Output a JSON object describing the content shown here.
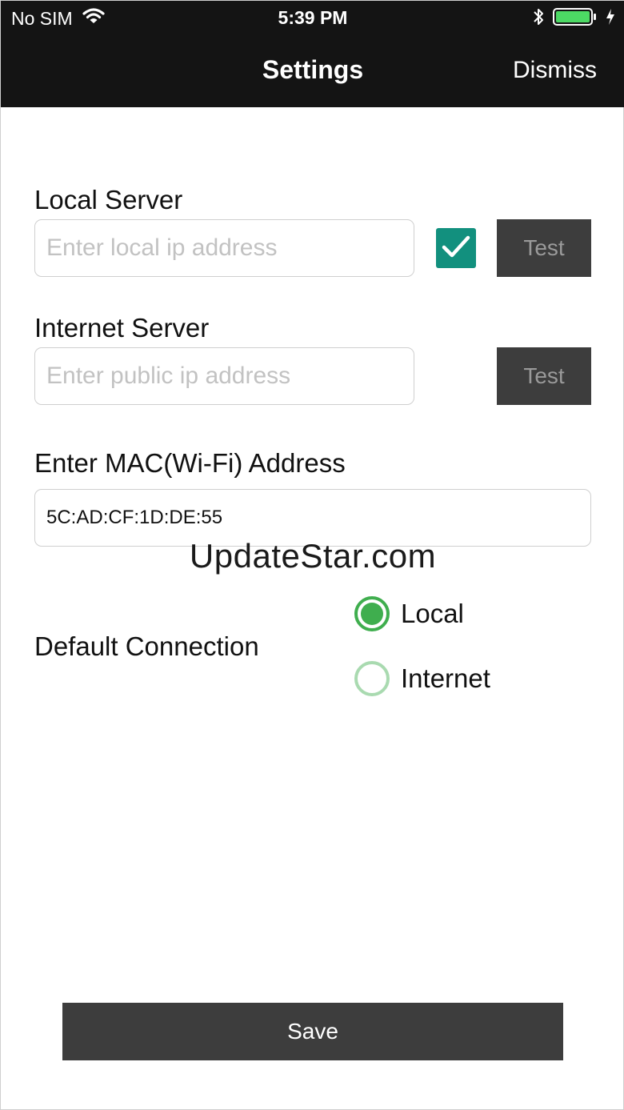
{
  "status_bar": {
    "carrier": "No SIM",
    "time": "5:39 PM",
    "battery_color": "#4cd964"
  },
  "nav": {
    "title": "Settings",
    "dismiss_label": "Dismiss"
  },
  "local_server": {
    "label": "Local Server",
    "placeholder": "Enter local ip address",
    "value": "",
    "checked": true,
    "test_label": "Test"
  },
  "internet_server": {
    "label": "Internet Server",
    "placeholder": "Enter public ip address",
    "value": "",
    "test_label": "Test"
  },
  "mac": {
    "label": "Enter MAC(Wi-Fi) Address",
    "value": "5C:AD:CF:1D:DE:55"
  },
  "watermark": "UpdateStar.com",
  "default_connection": {
    "label": "Default Connection",
    "options": [
      {
        "label": "Local",
        "selected": true
      },
      {
        "label": "Internet",
        "selected": false
      }
    ]
  },
  "save_label": "Save",
  "colors": {
    "header_bg": "#141414",
    "checkbox": "#12907e",
    "radio_selected": "#3fae4e",
    "button_bg": "#3d3d3d"
  }
}
